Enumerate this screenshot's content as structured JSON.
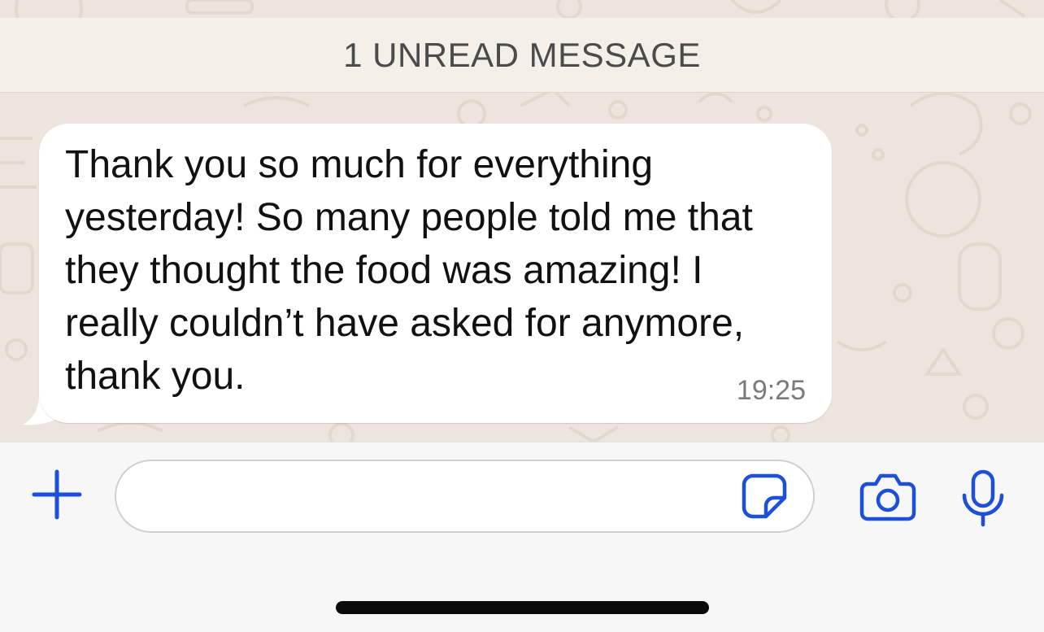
{
  "chat": {
    "unread_banner": "1 UNREAD MESSAGE",
    "message": {
      "text": "Thank you so much for everything\nyesterday! So many people told me that\nthey thought the food was amazing! I\nreally couldn’t have asked for anymore,\nthank you.",
      "time": "19:25"
    }
  },
  "input_bar": {
    "message_value": "",
    "icons": {
      "attach": "plus-icon",
      "sticker": "sticker-icon",
      "camera": "camera-icon",
      "voice": "microphone-icon"
    }
  },
  "colors": {
    "accent": "#1d4fd8",
    "chat_background": "#ece5dd",
    "banner_background": "#f4f0e9",
    "bubble": "#ffffff"
  }
}
